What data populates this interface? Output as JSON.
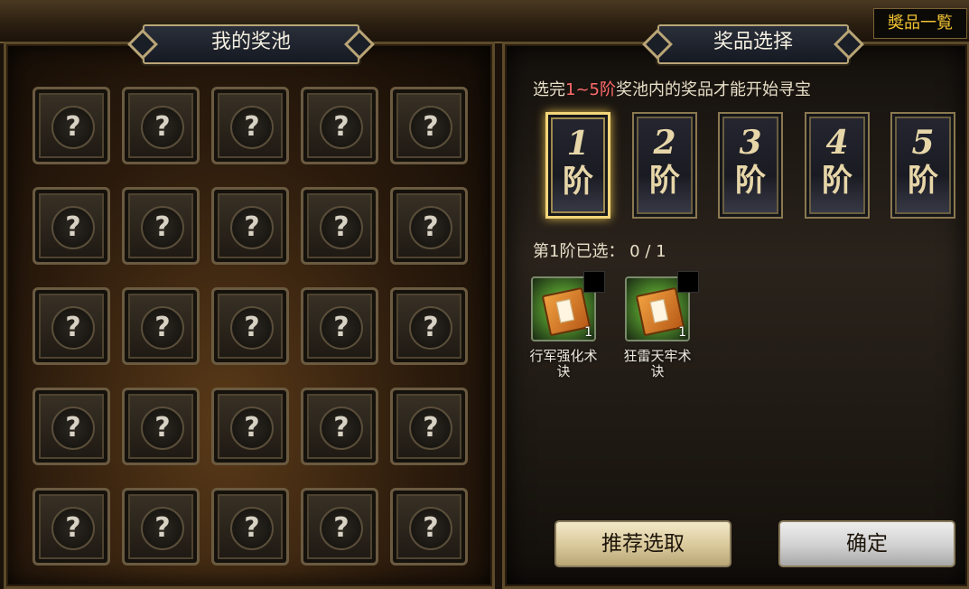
{
  "header": {
    "prize_list_button": "奬品一覧"
  },
  "left_panel": {
    "title": "我的奖池",
    "slot_symbol": "?",
    "slots": [
      "?",
      "?",
      "?",
      "?",
      "?",
      "?",
      "?",
      "?",
      "?",
      "?",
      "?",
      "?",
      "?",
      "?",
      "?",
      "?",
      "?",
      "?",
      "?",
      "?",
      "?",
      "?",
      "?",
      "?",
      "?"
    ]
  },
  "right_panel": {
    "title": "奖品选择",
    "hint": {
      "prefix": "选完",
      "highlight": "1~5阶",
      "suffix": "奖池内的奖品才能开始寻宝"
    },
    "tiers": [
      {
        "num": "1",
        "label": "阶",
        "active": true
      },
      {
        "num": "2",
        "label": "阶",
        "active": false
      },
      {
        "num": "3",
        "label": "阶",
        "active": false
      },
      {
        "num": "4",
        "label": "阶",
        "active": false
      },
      {
        "num": "5",
        "label": "阶",
        "active": false
      }
    ],
    "selected_count": "第1阶已选： 0 / 1",
    "items": [
      {
        "name_line1": "行军强化术",
        "name_line2": "诀",
        "qty": "1",
        "icon": "skill-book-icon"
      },
      {
        "name_line1": "狂雷天牢术",
        "name_line2": "诀",
        "qty": "1",
        "icon": "skill-book-icon"
      }
    ],
    "buttons": {
      "recommend": "推荐选取",
      "confirm": "确定"
    }
  },
  "colors": {
    "accent_gold": "#f1c232",
    "hint_highlight": "#ff6b6b",
    "active_tier_glow": "#f3d57a"
  }
}
